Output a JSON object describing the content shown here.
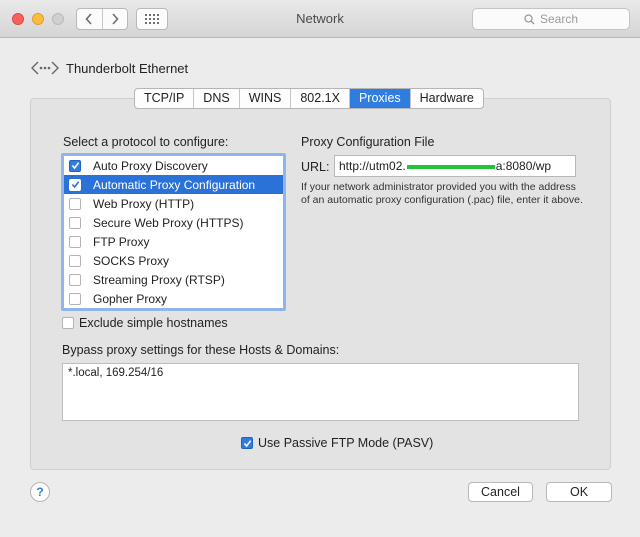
{
  "window": {
    "title": "Network"
  },
  "search": {
    "placeholder": "Search"
  },
  "interface": {
    "name": "Thunderbolt Ethernet"
  },
  "tabs": [
    {
      "label": "TCP/IP"
    },
    {
      "label": "DNS"
    },
    {
      "label": "WINS"
    },
    {
      "label": "802.1X"
    },
    {
      "label": "Proxies",
      "active": true
    },
    {
      "label": "Hardware"
    }
  ],
  "protocols": {
    "heading": "Select a protocol to configure:",
    "items": [
      {
        "label": "Auto Proxy Discovery",
        "checked": true
      },
      {
        "label": "Automatic Proxy Configuration",
        "checked": true,
        "selected": true
      },
      {
        "label": "Web Proxy (HTTP)",
        "checked": false
      },
      {
        "label": "Secure Web Proxy (HTTPS)",
        "checked": false
      },
      {
        "label": "FTP Proxy",
        "checked": false
      },
      {
        "label": "SOCKS Proxy",
        "checked": false
      },
      {
        "label": "Streaming Proxy (RTSP)",
        "checked": false
      },
      {
        "label": "Gopher Proxy",
        "checked": false
      }
    ]
  },
  "exclude_simple": {
    "label": "Exclude simple hostnames",
    "checked": false
  },
  "config_file": {
    "title": "Proxy Configuration File",
    "url_label": "URL:",
    "url_prefix": "http://utm02.",
    "url_suffix": "a:8080/wp",
    "help": "If your network administrator provided you with the address of an automatic proxy configuration (.pac) file, enter it above."
  },
  "bypass": {
    "label": "Bypass proxy settings for these Hosts & Domains:",
    "value": "*.local, 169.254/16"
  },
  "passive_ftp": {
    "label": "Use Passive FTP Mode (PASV)",
    "checked": true
  },
  "buttons": {
    "help": "?",
    "cancel": "Cancel",
    "ok": "OK"
  },
  "colors": {
    "accent": "#2f7de1",
    "selection": "#2a72d8",
    "redaction": "#22c33a"
  }
}
